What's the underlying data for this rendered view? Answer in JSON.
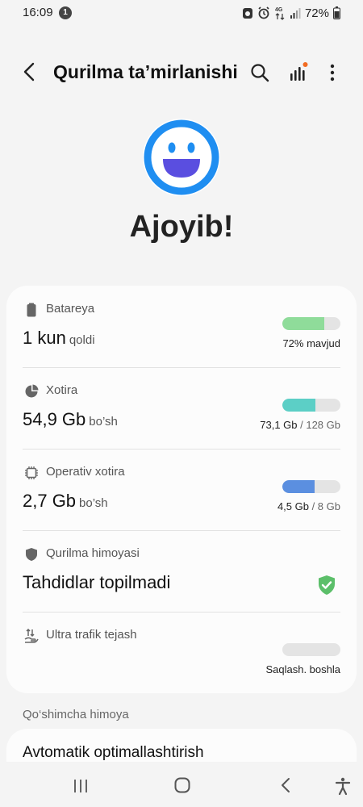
{
  "status_bar": {
    "time": "16:09",
    "notification_count": "1",
    "battery": "72%",
    "network": "4G"
  },
  "header": {
    "title": "Qurilma taʼmirlanishi",
    "icons": [
      "back-icon",
      "search-icon",
      "stats-icon",
      "more-options-icon"
    ]
  },
  "hero": {
    "status_text": "Ajoyib!",
    "icon": "smiley-face-icon",
    "color": "#1f8ef1"
  },
  "items": [
    {
      "title": "Batareya",
      "value": "1 kun",
      "unit": "qoldi",
      "detail": "72% mavjud",
      "progress": 0.72,
      "color": "#8fdc9a",
      "icon": "battery-icon"
    },
    {
      "title": "Xotira",
      "value": "54,9 Gb",
      "unit": "bo’sh",
      "detail_used": "73,1 Gb",
      "detail_total": " / 128 Gb",
      "progress": 0.57,
      "color": "#5ccfc6",
      "icon": "storage-icon"
    },
    {
      "title": "Operativ xotira",
      "value": "2,7 Gb",
      "unit": "bo’sh",
      "detail_used": "4,5 Gb",
      "detail_total": " / 8 Gb",
      "progress": 0.56,
      "color": "#5b8fe0",
      "icon": "memory-chip-icon"
    },
    {
      "title": "Qurilma himoyasi",
      "value": "Tahdidlar topilmadi",
      "icon": "shield-icon",
      "status_icon": "shield-check-icon",
      "status_color": "#5cbf6a"
    },
    {
      "title": "Ultra trafik tejash",
      "detail": "Saqlash. boshla",
      "progress": 0,
      "icon": "data-saver-icon"
    }
  ],
  "section_header": "Qo‘shimcha himoya",
  "bottom_item": "Avtomatik optimallashtirish",
  "nav": {
    "icons": [
      "recent-apps-icon",
      "home-icon",
      "back-nav-icon",
      "accessibility-icon"
    ]
  }
}
